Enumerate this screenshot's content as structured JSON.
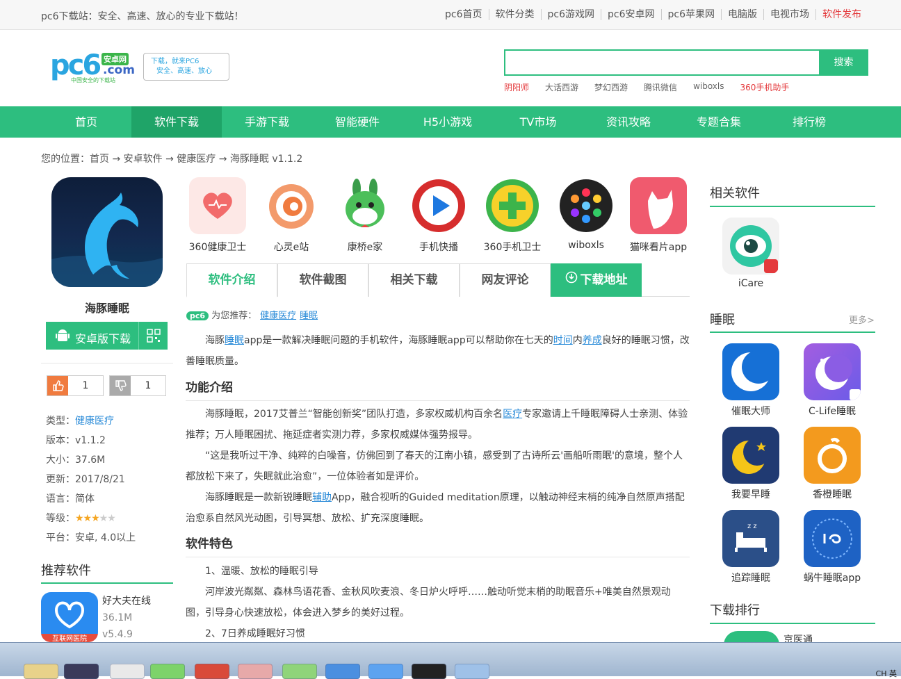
{
  "topbar": {
    "slogan": "pc6下载站：安全、高速、放心的专业下载站！",
    "links": [
      "pc6首页",
      "软件分类",
      "pc6游戏网",
      "pc6安卓网",
      "pc6苹果网",
      "电脑版",
      "电视市场",
      "软件发布"
    ]
  },
  "logo": {
    "pc6": "pc6",
    "anzhuo": "安卓网",
    "com": ".com",
    "sub": "中国安全的下载站",
    "badge_line1": "下载，就来PC6",
    "badge_line2": "安全、高速、放心"
  },
  "search": {
    "button": "搜索",
    "hotwords": [
      "阴阳师",
      "大话西游",
      "梦幻西游",
      "腾讯微信",
      "wiboxls",
      "360手机助手"
    ]
  },
  "nav": [
    "首页",
    "软件下载",
    "手游下载",
    "智能硬件",
    "H5小游戏",
    "TV市场",
    "资讯攻略",
    "专题合集",
    "排行榜"
  ],
  "breadcrumb": "您的位置：首页 → 安卓软件 → 健康医疗 → 海豚睡眠 v1.1.2",
  "app": {
    "name": "海豚睡眠",
    "download": "安卓版下载",
    "likes": "1",
    "dislikes": "1",
    "info": {
      "type_label": "类型：",
      "type": "健康医疗",
      "version": "版本：v1.1.2",
      "size": "大小：37.6M",
      "update": "更新：2017/8/21",
      "lang": "语言：简体",
      "level_label": "等级：",
      "rating": 3,
      "platform": "平台：安卓, 4.0以上"
    }
  },
  "recommend": {
    "title": "推荐软件",
    "item": {
      "name": "好大夫在线",
      "size": "36.1M",
      "version": "v5.4.9",
      "ribbon": "互联网医院"
    }
  },
  "related_row": [
    "360健康卫士",
    "心灵e站",
    "康桥e家",
    "手机快播",
    "360手机卫士",
    "wiboxls",
    "猫咪看片app"
  ],
  "tabs": [
    "软件介绍",
    "软件截图",
    "相关下载",
    "网友评论",
    "下载地址"
  ],
  "recline": {
    "prefix": "为您推荐：",
    "badge": "pc6",
    "links": [
      "健康医疗",
      "睡眠"
    ]
  },
  "content": {
    "intro": [
      "海豚",
      "睡眠",
      "app是一款解决睡眠问题的手机软件，海豚睡眠app可以帮助你在七天的",
      "时间",
      "内",
      "养成",
      "良好的睡眠习惯，改善睡眠质量。"
    ],
    "h_func": "功能介绍",
    "func1": [
      "海豚睡眠，2017艾普兰“智能创新奖”团队打造，多家权威机构百余名",
      "医疗",
      "专家邀请上千睡眠障碍人士亲测、体验推荐；万人睡眠困扰、拖延症者实测力荐，多家权威媒体强势报导。"
    ],
    "func2": "“这是我听过干净、纯粹的白噪音，仿佛回到了春天的江南小镇，感受到了古诗所云'画船听雨眠'的意境，整个人都放松下来了，失眠就此治愈”，一位体验者如是评价。",
    "func3": [
      "海豚睡眠是一款新锐睡眠",
      "辅助",
      "App，融合视听的Guided meditation原理，以触动神经末梢的纯净自然原声搭配治愈系自然风光动图，引导冥想、放松、扩充深度睡眠。"
    ],
    "h_feat": "软件特色",
    "feat1": "1、温暖、放松的睡眠引导",
    "feat1_desc": "河岸波光粼粼、森林鸟语花香、金秋风吹麦浪、冬日炉火呼呼……触动听觉末梢的助眠音乐+唯美自然景观动图，引导身心快速放松，体会进入梦乡的美好过程。",
    "feat2": "2、7日养成睡眠好习惯"
  },
  "right": {
    "related_title": "相关软件",
    "related_app": "iCare",
    "sleep_title": "睡眠",
    "more": "更多>",
    "sleep_apps": [
      "催眠大师",
      "C-Life睡眠",
      "我要早睡",
      "香橙睡眠",
      "追踪睡眠",
      "蜗牛睡眠app"
    ],
    "rank_title": "下载排行",
    "rank_first": "京医通"
  },
  "taskbar": {
    "tray": "CH 英"
  }
}
